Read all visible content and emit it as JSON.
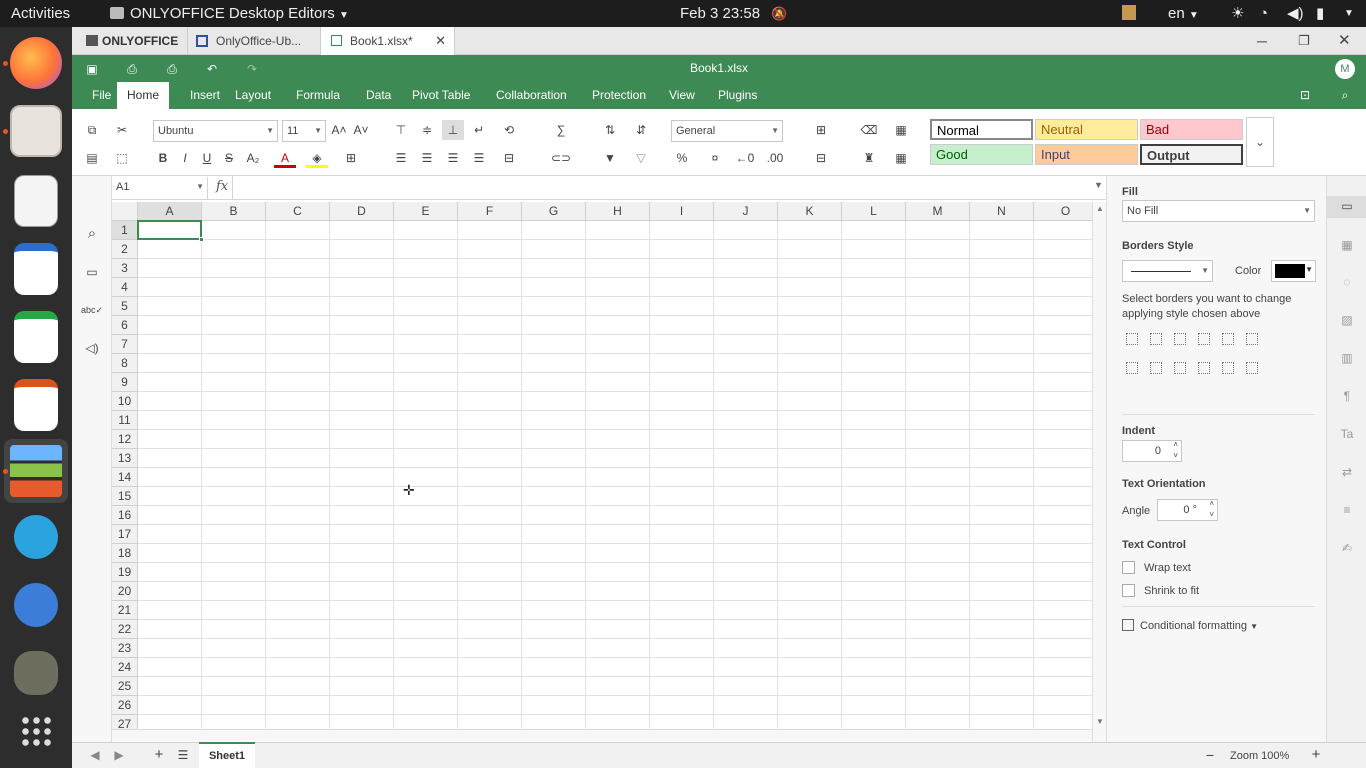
{
  "system": {
    "activities": "Activities",
    "app_menu": "ONLYOFFICE Desktop Editors",
    "datetime": "Feb 3  23:58",
    "lang": "en"
  },
  "tabs": [
    {
      "label": "ONLYOFFICE"
    },
    {
      "label": "OnlyOffice-Ub..."
    },
    {
      "label": "Book1.xlsx*"
    }
  ],
  "doc_title": "Book1.xlsx",
  "user_initial": "M",
  "menu": [
    "File",
    "Home",
    "Insert",
    "Layout",
    "Formula",
    "Data",
    "Pivot Table",
    "Collaboration",
    "Protection",
    "View",
    "Plugins"
  ],
  "ribbon": {
    "font": "Ubuntu",
    "size": "11",
    "format": "General",
    "styles": [
      {
        "label": "Normal",
        "bg": "#ffffff",
        "fg": "#000000"
      },
      {
        "label": "Neutral",
        "bg": "#ffeb9c",
        "fg": "#9c6500"
      },
      {
        "label": "Bad",
        "bg": "#ffc7ce",
        "fg": "#9c0006"
      },
      {
        "label": "Good",
        "bg": "#c6efce",
        "fg": "#006100"
      },
      {
        "label": "Input",
        "bg": "#ffcc99",
        "fg": "#3f3f76"
      },
      {
        "label": "Output",
        "bg": "#f2f2f2",
        "fg": "#3f3f3f"
      }
    ]
  },
  "formula": {
    "cell_ref": "A1",
    "fx": "fx",
    "value": ""
  },
  "columns": [
    "A",
    "B",
    "C",
    "D",
    "E",
    "F",
    "G",
    "H",
    "I",
    "J",
    "K",
    "L",
    "M",
    "N",
    "O"
  ],
  "rows": [
    "1",
    "2",
    "3",
    "4",
    "5",
    "6",
    "7",
    "8",
    "9",
    "10",
    "11",
    "12",
    "13",
    "14",
    "15",
    "16",
    "17",
    "18",
    "19",
    "20",
    "21",
    "22",
    "23",
    "24",
    "25",
    "26",
    "27"
  ],
  "panel": {
    "fill_h": "Fill",
    "fill_val": "No Fill",
    "borders_h": "Borders Style",
    "color_l": "Color",
    "borders_hint": "Select borders you want to change applying style chosen above",
    "indent_h": "Indent",
    "indent_val": "0",
    "orient_h": "Text Orientation",
    "angle_l": "Angle",
    "angle_val": "0 °",
    "control_h": "Text Control",
    "wrap": "Wrap text",
    "shrink": "Shrink to fit",
    "cond": "Conditional formatting"
  },
  "bottom": {
    "sheet": "Sheet1",
    "zoom": "Zoom 100%"
  }
}
